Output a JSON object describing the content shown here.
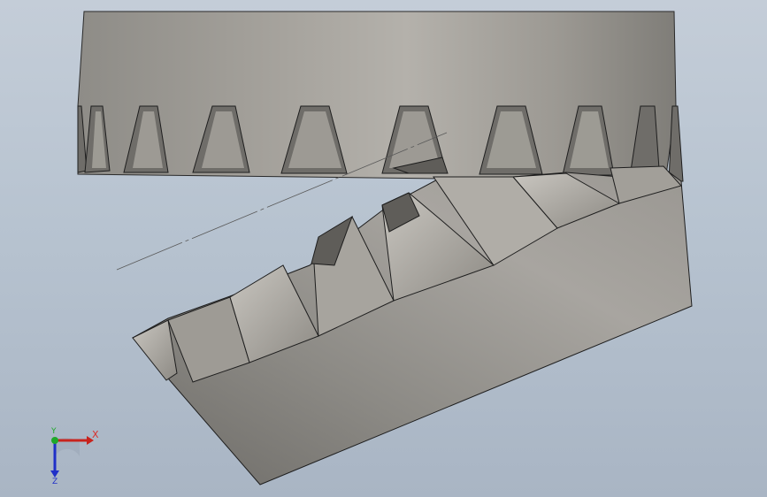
{
  "viewport": {
    "background_top": "#c4cdd8",
    "background_bottom": "#a9b5c4",
    "model": "gear-and-rack"
  },
  "triad": {
    "x_label": "X",
    "y_label": "Y",
    "z_label": "Z",
    "x_color": "#c8231d",
    "y_color": "#1fa82a",
    "z_color": "#1f2fc8"
  }
}
